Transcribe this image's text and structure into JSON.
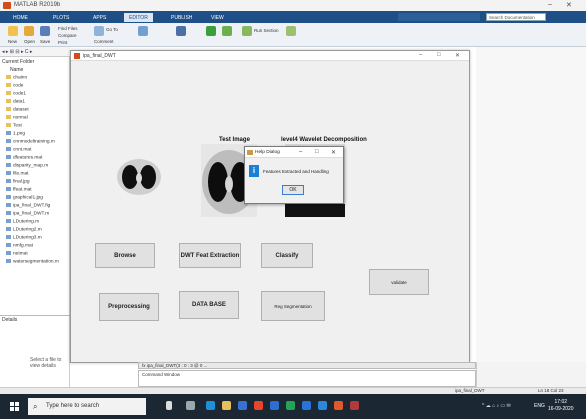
{
  "app": {
    "window_title": "MATLAB R2019b",
    "figure_title": "ipa_final_DWT"
  },
  "tabs": [
    "HOME",
    "PLOTS",
    "APPS",
    "EDITOR",
    "PUBLISH",
    "VIEW"
  ],
  "active_tab": "EDITOR",
  "search_placeholder": "Search Documentation",
  "ribbon": {
    "new": "New",
    "open": "Open",
    "save": "Save",
    "find_files": "Find Files",
    "compare": "Compare",
    "go_to": "Go To",
    "comment": "Comment",
    "print": "Print",
    "breakpoints": "Breakpoints",
    "run_section": "Run Section"
  },
  "left_pane": {
    "header": "Current Folder",
    "name_col": "Name",
    "items": [
      {
        "name": "chainn",
        "type": "folder"
      },
      {
        "name": "code",
        "type": "folder"
      },
      {
        "name": "code1",
        "type": "folder"
      },
      {
        "name": "data1",
        "type": "folder"
      },
      {
        "name": "dataset",
        "type": "folder"
      },
      {
        "name": "normal",
        "type": "folder"
      },
      {
        "name": "Test",
        "type": "folder"
      },
      {
        "name": "1.png",
        "type": "file"
      },
      {
        "name": "cnnmodeltraining.m",
        "type": "file"
      },
      {
        "name": "cnnt.mat",
        "type": "file"
      },
      {
        "name": "dfeatures.mat",
        "type": "file"
      },
      {
        "name": "disparity_map.m",
        "type": "file"
      },
      {
        "name": "file.mat",
        "type": "file"
      },
      {
        "name": "final.jpg",
        "type": "file"
      },
      {
        "name": "ffeat.mat",
        "type": "file"
      },
      {
        "name": "graphical1.jpg",
        "type": "file"
      },
      {
        "name": "ipa_final_DWT.fig",
        "type": "file"
      },
      {
        "name": "ipa_final_DWT.m",
        "type": "file"
      },
      {
        "name": "LDutering.m",
        "type": "file"
      },
      {
        "name": "LDutering2.m",
        "type": "file"
      },
      {
        "name": "LDutering3.m",
        "type": "file"
      },
      {
        "name": "nmfg.mat",
        "type": "file"
      },
      {
        "name": "netmat",
        "type": "file"
      },
      {
        "name": "watersegmentation.m",
        "type": "file"
      }
    ],
    "details": "Details",
    "select_file": "Select a file to view details"
  },
  "figure": {
    "axis_titles": {
      "test_image": "Test Image",
      "wavelet": "level4 Wavelet Decomposition"
    },
    "buttons": {
      "browse": "Browse",
      "dwt": "DWT Feat Extraction",
      "classify": "Classify",
      "preprocessing": "Preprocessing",
      "database": "DATA BASE",
      "region_seg": "Reg Segmentation",
      "validate": "validate"
    }
  },
  "help_dialog": {
    "title": "Help Dialog",
    "message": "Features Extracted and Handling",
    "ok": "OK"
  },
  "command": {
    "tab_label": "fx   ipa_final_DWT(3 : 0 : 3 @ 0 ...",
    "window_label": "Command Window"
  },
  "status": {
    "file": "ipa_final_DWT",
    "ln": "Ln 18   Col 23"
  },
  "taskbar": {
    "search_placeholder": "Type here to search",
    "time": "17:02",
    "date": "16-09-2020",
    "lang": "ENG"
  },
  "colors": {
    "tab_blue": "#1e4f86",
    "info_blue": "#1b7fd6",
    "taskbar": "#1b2733"
  }
}
